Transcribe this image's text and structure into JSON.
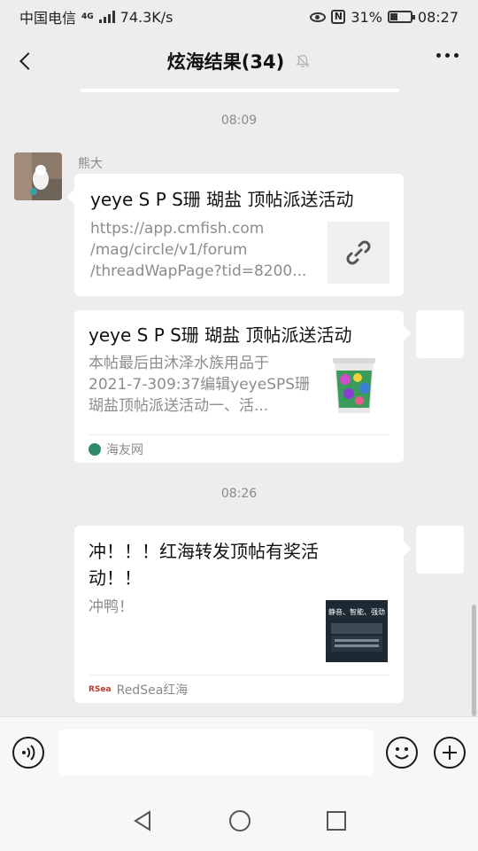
{
  "status_bar": {
    "carrier": "中国电信",
    "network": "4G",
    "speed": "74.3K/s",
    "battery": "31%",
    "time": "08:27"
  },
  "nav": {
    "title": "炫海结果(34)",
    "icons": [
      "back-icon",
      "mute-icon",
      "more-icon"
    ]
  },
  "chat": {
    "time_1": "08:09",
    "time_2": "08:26",
    "messages": [
      {
        "sender": "熊大",
        "title": "yeye S P S珊 瑚盐 顶帖派送活动",
        "desc": [
          "https://app.cmfish.com",
          "/mag/circle/v1/forum",
          "/threadWapPage?tid=8200..."
        ],
        "thumb_icon": "link-icon"
      },
      {
        "title": "yeye S P S珊 瑚盐 顶帖派送活动",
        "desc": [
          "本帖最后由沐泽水族用品于",
          "2021-7-309:37编辑yeyeSPS珊",
          "瑚盐顶帖派送活动一、活..."
        ],
        "source": "海友网"
      },
      {
        "title": [
          "冲！！！红海转发顶帖有奖活",
          "动！！"
        ],
        "desc": [
          "冲鸭！"
        ],
        "thumb_text": "静音、智能、强劲",
        "source": "RedSea红海",
        "source_logo": "RedSea"
      }
    ]
  },
  "input_bar": {
    "placeholder": "",
    "icons": [
      "voice-icon",
      "emoji-icon",
      "plus-icon"
    ]
  },
  "colors": {
    "background": "#ededed",
    "bubble": "#ffffff",
    "muted_text": "#8a8a8a"
  }
}
